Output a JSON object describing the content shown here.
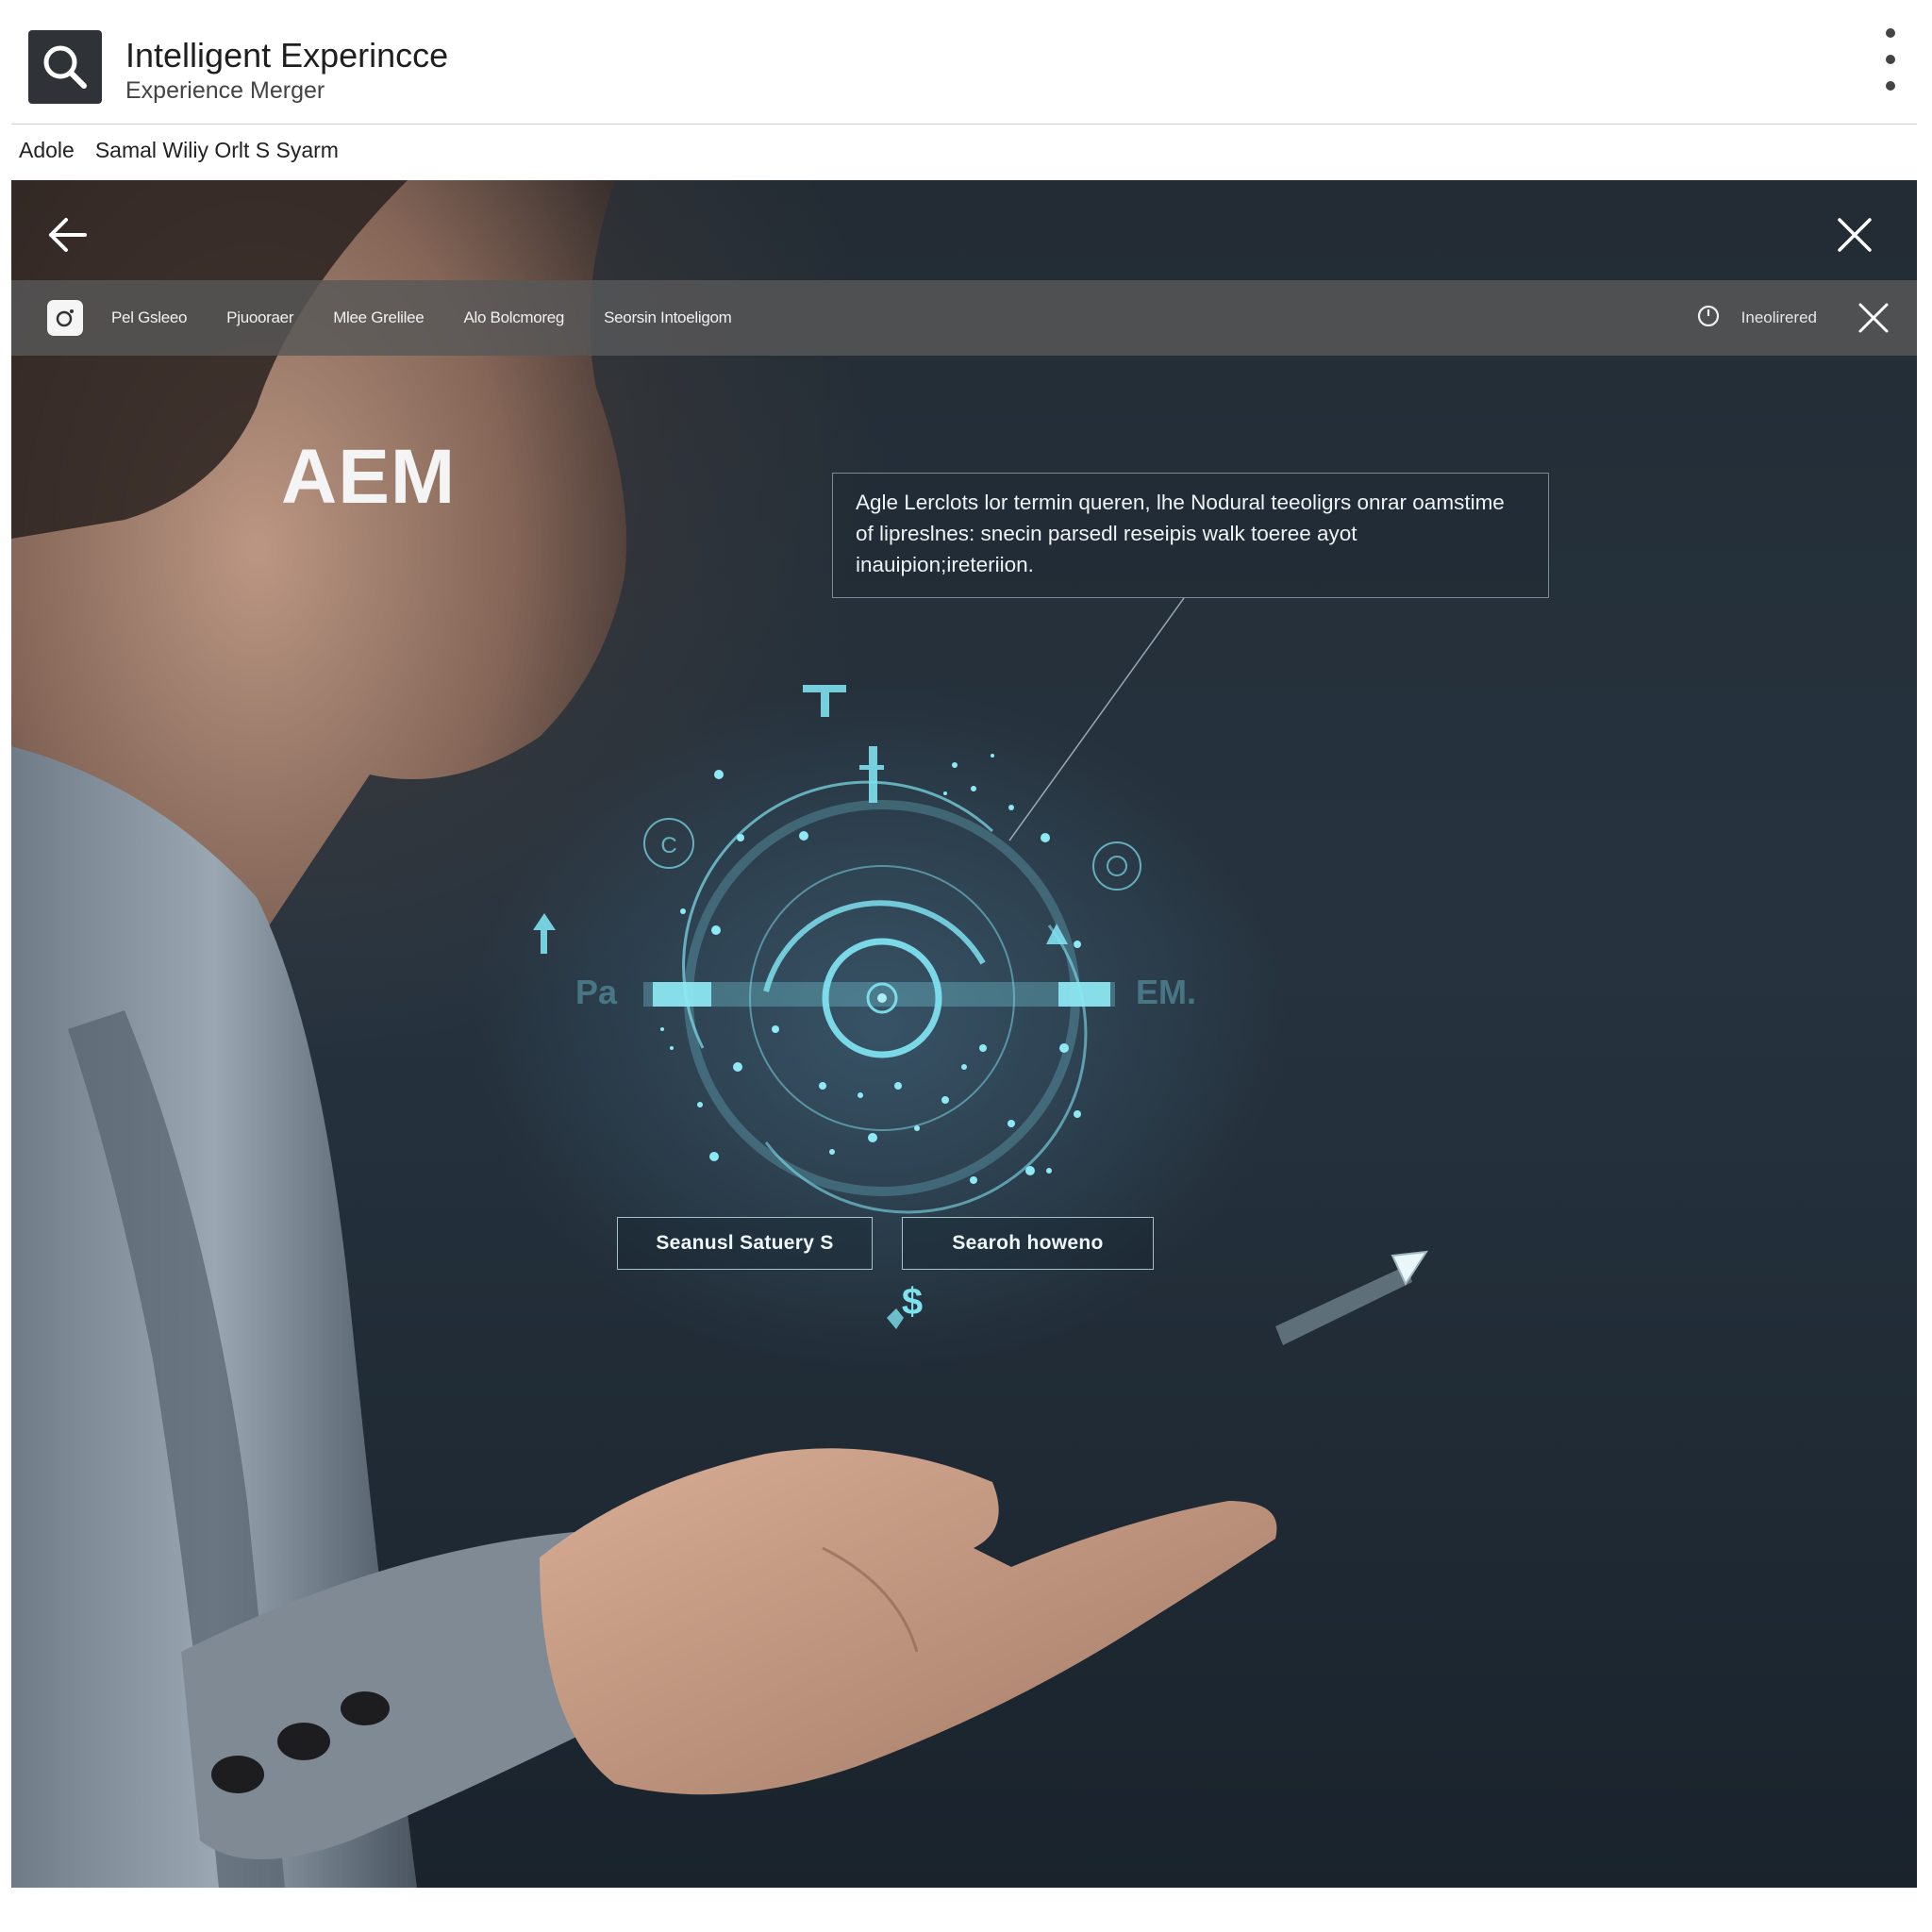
{
  "header": {
    "title": "Intelligent Experincce",
    "subtitle": "Experience Merger"
  },
  "breadcrumb": {
    "items": [
      "Adole",
      "Samal Wiliy Orlt S Syarm"
    ]
  },
  "toolbar": {
    "links": [
      "Pel Gsleeo",
      "Pjuooraer",
      "Mlee Grelilee",
      "Alo Bolcmoreg",
      "Seorsin Intoeligom"
    ],
    "status": "Ineolirered"
  },
  "hero": {
    "heading": "AEM",
    "callout": "Agle Lerclots lor termin queren, lhe Nodural teeoligrs onrar oamstime of lipreslnes: snecin parsedl reseipis walk toeree ayot inauipion;ireteriion.",
    "hud_left_text": "Pa",
    "hud_right_text": "EM.",
    "buttons": [
      "Seanusl Satuery S",
      "Searoh howeno"
    ],
    "currency_symbol": "$"
  },
  "colors": {
    "accent_cyan": "#7fe0ee",
    "toolbar_bg": "#585858",
    "hero_bg": "#232c34"
  },
  "icons": {
    "app_logo": "search-icon",
    "menu": "kebab-menu-icon",
    "back": "arrow-left-icon",
    "close": "close-icon",
    "toolbar_app": "camera-icon",
    "status": "clock-icon"
  }
}
